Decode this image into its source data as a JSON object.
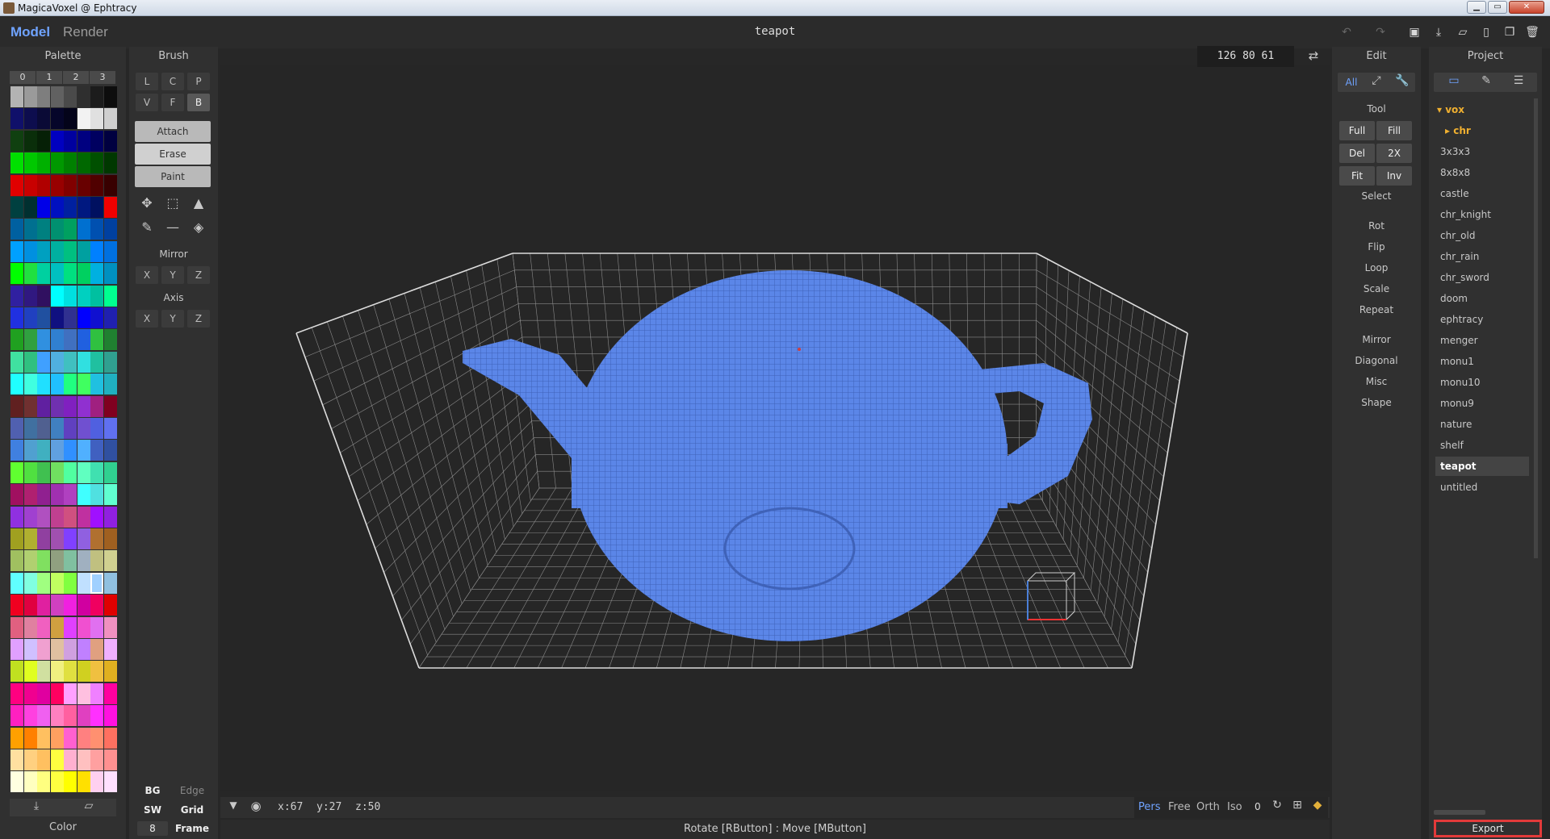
{
  "window": {
    "title": "MagicaVoxel @ Ephtracy",
    "min": "▭",
    "max": "▭",
    "close": "✕"
  },
  "tabs": {
    "model": "Model",
    "render": "Render"
  },
  "file_title": "teapot",
  "palette": {
    "title": "Palette",
    "pages": [
      "0",
      "1",
      "2",
      "3"
    ],
    "footer_label": "Color",
    "rows": [
      [
        "#b3b3b3",
        "#9a9a9a",
        "#7e7e7e",
        "#616161",
        "#4a4a4a",
        "#2f2f2f",
        "#1c1c1c",
        "#0d0d0d"
      ],
      [
        "#10106a",
        "#0d0d4e",
        "#0a0a36",
        "#06062a",
        "#04041a",
        "#f2f2f2",
        "#e0e0e0",
        "#cfcfcf"
      ],
      [
        "#104010",
        "#0a2e0a",
        "#062006",
        "#0000c0",
        "#0000a0",
        "#000080",
        "#000060",
        "#000040"
      ],
      [
        "#00e000",
        "#00c800",
        "#00b000",
        "#009800",
        "#008000",
        "#006800",
        "#005000",
        "#003800"
      ],
      [
        "#e00000",
        "#c80000",
        "#b00000",
        "#980000",
        "#800000",
        "#680000",
        "#500000",
        "#380000"
      ],
      [
        "#004040",
        "#003030",
        "#0000e8",
        "#0010c0",
        "#0020a0",
        "#001880",
        "#001060",
        "#f00000"
      ],
      [
        "#0060a0",
        "#007090",
        "#008080",
        "#009070",
        "#00a060",
        "#0070d0",
        "#0050b0",
        "#0040a0"
      ],
      [
        "#00a0ff",
        "#0090e0",
        "#00a0c0",
        "#00b0a0",
        "#00c080",
        "#00a0a0",
        "#0080ff",
        "#0070e0"
      ],
      [
        "#00ff00",
        "#20e040",
        "#00d0a0",
        "#00c0c0",
        "#00e080",
        "#00d060",
        "#00b0e0",
        "#0090c0"
      ],
      [
        "#3020a0",
        "#301880",
        "#301060",
        "#00ffff",
        "#00e0e0",
        "#00d0c0",
        "#00c0a0",
        "#00ff90"
      ],
      [
        "#2030e0",
        "#2040c0",
        "#2050a0",
        "#101080",
        "#303090",
        "#0000ff",
        "#1010d0",
        "#2020b0"
      ],
      [
        "#20a020",
        "#30a040",
        "#3090e0",
        "#3080d0",
        "#4070c0",
        "#2060e0",
        "#30c040",
        "#208030"
      ],
      [
        "#40e0a0",
        "#30c080",
        "#40a0ff",
        "#50b0e0",
        "#40c0c0",
        "#30e0e0",
        "#20c0a0",
        "#30a090"
      ],
      [
        "#20ffff",
        "#40ffe0",
        "#20e0ff",
        "#20c0ff",
        "#20ff80",
        "#40ff60",
        "#20c0e0",
        "#20b0c0"
      ],
      [
        "#602020",
        "#703030",
        "#6020a0",
        "#7030b0",
        "#8020c0",
        "#9030d0",
        "#a02080",
        "#800020"
      ],
      [
        "#5060b0",
        "#4070a0",
        "#506090",
        "#4080c0",
        "#6040c0",
        "#7050d0",
        "#5060e0",
        "#6070f0"
      ],
      [
        "#4080e0",
        "#50a0d0",
        "#40b0c0",
        "#60a0e0",
        "#3090ff",
        "#50b0ff",
        "#4060c0",
        "#3050a0"
      ],
      [
        "#60ff30",
        "#50e040",
        "#40c050",
        "#70e060",
        "#50ffa0",
        "#60ffc0",
        "#40e0b0",
        "#30d090"
      ],
      [
        "#a01060",
        "#b02070",
        "#902090",
        "#a030b0",
        "#b040c0",
        "#40ffff",
        "#50e0e0",
        "#60ffd0"
      ],
      [
        "#9030e0",
        "#a040d0",
        "#b050c0",
        "#c04090",
        "#d05080",
        "#c030a0",
        "#a010ff",
        "#9020e0"
      ],
      [
        "#a0a020",
        "#b0b030",
        "#9040a0",
        "#a050b0",
        "#8040ff",
        "#9060e0",
        "#b07030",
        "#a06020"
      ],
      [
        "#a0c060",
        "#b0d070",
        "#80e060",
        "#90a080",
        "#80c0a0",
        "#a0b0c0",
        "#c0c080",
        "#d0d090"
      ],
      [
        "#60ffff",
        "#80ffe0",
        "#a0ff80",
        "#c0ff60",
        "#80ff40",
        "#c0e0ff",
        "#a0d0ff",
        "#90c0e0"
      ],
      [
        "#f00020",
        "#e00040",
        "#e020a0",
        "#d040c0",
        "#f020e0",
        "#d000a0",
        "#f00060",
        "#e00000"
      ],
      [
        "#e06080",
        "#e080a0",
        "#f060c0",
        "#d0a040",
        "#e040ff",
        "#f050d0",
        "#e070f0",
        "#f090c0"
      ],
      [
        "#e0a0ff",
        "#d0c0ff",
        "#f0a0d0",
        "#e0c0a0",
        "#d0a0e0",
        "#c080ff",
        "#e0a080",
        "#f0b0ff"
      ],
      [
        "#c0e020",
        "#e0ff20",
        "#d0e0a0",
        "#f0f080",
        "#e0e040",
        "#d0d020",
        "#f0c040",
        "#e0b020"
      ],
      [
        "#ff0080",
        "#f00090",
        "#e000a0",
        "#ff0060",
        "#ffa0ff",
        "#ffc0e0",
        "#f080ff",
        "#ff00a0"
      ],
      [
        "#ff20c0",
        "#ff40e0",
        "#f060f0",
        "#ff80c0",
        "#ff60a0",
        "#e040c0",
        "#ff30ff",
        "#ff10e0"
      ],
      [
        "#ffa000",
        "#ff8000",
        "#ffc060",
        "#ffa060",
        "#ff60d0",
        "#ff8080",
        "#ff9070",
        "#ff7060"
      ],
      [
        "#ffe0a0",
        "#ffd080",
        "#ffc060",
        "#ffff40",
        "#ffb0d0",
        "#ffc0c0",
        "#ffa0a0",
        "#ff9090"
      ],
      [
        "#ffffe0",
        "#ffffc0",
        "#ffff80",
        "#ffff40",
        "#ffff00",
        "#ffe000",
        "#ffd0f0",
        "#ffe0ff"
      ]
    ]
  },
  "brush": {
    "title": "Brush",
    "shape_row1": [
      "L",
      "C",
      "P"
    ],
    "shape_row2": [
      "V",
      "F",
      "B"
    ],
    "modes": [
      "Attach",
      "Erase",
      "Paint"
    ],
    "mirror_label": "Mirror",
    "axis_label": "Axis",
    "xyz": [
      "X",
      "Y",
      "Z"
    ],
    "bottom": {
      "bg": "BG",
      "edge": "Edge",
      "sw": "SW",
      "grid": "Grid",
      "frame_value": "8",
      "frame": "Frame"
    }
  },
  "viewport": {
    "dims": "126  80  61",
    "coords": {
      "x": "x:67",
      "y": "y:27",
      "z": "z:50"
    },
    "views": [
      "Pers",
      "Free",
      "Orth",
      "Iso"
    ],
    "zero": "0",
    "status": "Rotate [RButton] : Move [MButton]",
    "model_color": "#5b86e8"
  },
  "edit": {
    "title": "Edit",
    "mode_all": "All",
    "tool_label": "Tool",
    "tool_grid": [
      [
        "Full",
        "Fill"
      ],
      [
        "Del",
        "2X"
      ],
      [
        "Fit",
        "Inv"
      ]
    ],
    "select": "Select",
    "group1": [
      "Rot",
      "Flip",
      "Loop",
      "Scale",
      "Repeat"
    ],
    "group2": [
      "Mirror",
      "Diagonal",
      "Misc",
      "Shape"
    ]
  },
  "project": {
    "title": "Project",
    "folder": "vox",
    "subfolder": "chr",
    "items": [
      "3x3x3",
      "8x8x8",
      "castle",
      "chr_knight",
      "chr_old",
      "chr_rain",
      "chr_sword",
      "doom",
      "ephtracy",
      "menger",
      "monu1",
      "monu10",
      "monu9",
      "nature",
      "shelf",
      "teapot",
      "untitled"
    ],
    "selected": "teapot",
    "export": "Export"
  }
}
